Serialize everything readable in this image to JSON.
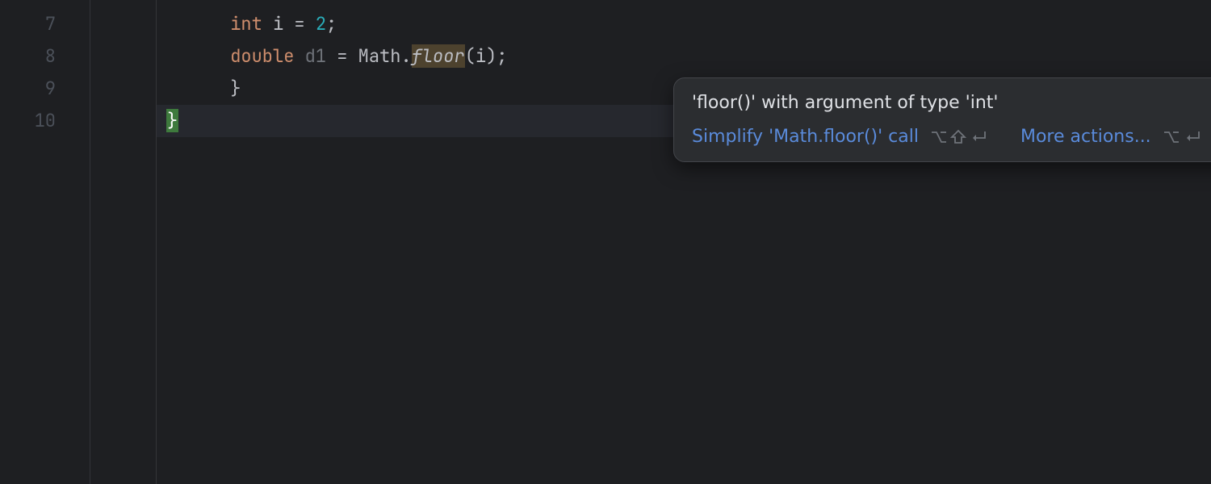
{
  "gutter": {
    "lines": [
      "7",
      "8",
      "9",
      "10"
    ]
  },
  "code": {
    "line7": {
      "indent": "      ",
      "kw": "int",
      "sp1": " ",
      "var": "i",
      "sp2": " ",
      "eq": "=",
      "sp3": " ",
      "num": "2",
      "semi": ";"
    },
    "line8": {
      "indent": "      ",
      "kw": "double",
      "sp1": " ",
      "var": "d1",
      "sp2": " ",
      "eq": "=",
      "sp3": " ",
      "cls": "Math",
      "dot": ".",
      "method": "floor",
      "lparen": "(",
      "arg": "i",
      "rparen": ")",
      "semi": ";"
    },
    "line9": {
      "indent": "      ",
      "brace": "}"
    },
    "line10": {
      "indent": "",
      "brace": "}"
    }
  },
  "tooltip": {
    "title": "'floor()' with argument of type 'int'",
    "action1": "Simplify 'Math.floor()' call",
    "action2": "More actions...",
    "shortcut1_name": "alt-shift-enter",
    "shortcut2_name": "alt-enter"
  },
  "icons": {
    "more": "more-vert-icon"
  }
}
